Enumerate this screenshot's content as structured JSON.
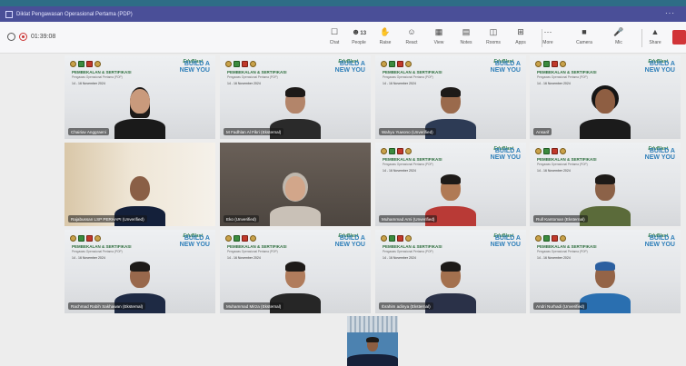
{
  "window": {
    "title": "Diklat Pengawasan Operasional Pertama (PDP)",
    "menu_glyph": "···"
  },
  "meeting": {
    "elapsed": "01:39:08"
  },
  "toolbar": [
    {
      "key": "chat",
      "label": "Chat",
      "icon": "chat-icon",
      "glyph": "☐"
    },
    {
      "key": "people",
      "label": "People",
      "icon": "people-icon",
      "glyph": "☻",
      "count": "13"
    },
    {
      "key": "raise",
      "label": "Raise",
      "icon": "hand-icon",
      "glyph": "✋"
    },
    {
      "key": "react",
      "label": "React",
      "icon": "smile-icon",
      "glyph": "☺"
    },
    {
      "key": "view",
      "label": "View",
      "icon": "grid-icon",
      "glyph": "▦"
    },
    {
      "key": "notes",
      "label": "Notes",
      "icon": "notes-icon",
      "glyph": "▤"
    },
    {
      "key": "rooms",
      "label": "Rooms",
      "icon": "rooms-icon",
      "glyph": "◫"
    },
    {
      "key": "apps",
      "label": "Apps",
      "icon": "apps-icon",
      "glyph": "⊞"
    },
    {
      "key": "more",
      "label": "More",
      "icon": "more-icon",
      "glyph": "···"
    },
    {
      "key": "camera",
      "label": "Camera",
      "icon": "camera-icon",
      "glyph": "■"
    },
    {
      "key": "mic",
      "label": "Mic",
      "icon": "mic-icon",
      "glyph": "🎤"
    },
    {
      "key": "share",
      "label": "Share",
      "icon": "share-icon",
      "glyph": "▲"
    }
  ],
  "banner": {
    "brand": "EduBlast",
    "tagline": "BUILD A NEW YOU",
    "heading": "PEMBEKALAN & SERTIFIKASI",
    "subheading": "Pengawas Operasional Pertama (POP)",
    "dates": "14 - 16   November 2024"
  },
  "participants": [
    {
      "name": "Chairiav Anggraeni",
      "bg": "banner",
      "skin": "#c99a7c",
      "shirt": "#1a1a1a",
      "hair": "long"
    },
    {
      "name": "M Fadhlan Al Fikri (Eksternal)",
      "bg": "banner",
      "skin": "#b3856a",
      "shirt": "#2a2a2a",
      "hair": "short"
    },
    {
      "name": "Wahyu Yuwono (Unverified)",
      "bg": "banner",
      "skin": "#9a6a4c",
      "shirt": "#2d3b55",
      "hair": "short"
    },
    {
      "name": "Ansarif",
      "bg": "banner",
      "skin": "#8e5e42",
      "shirt": "#1b1b1b",
      "hair": "hood"
    },
    {
      "name": "Rajabussan LSP PERHAPI (Unverified)",
      "bg": "room",
      "skin": "#8a5f46",
      "shirt": "#14203a",
      "hair": "bald"
    },
    {
      "name": "Eko (Unverified)",
      "bg": "dark",
      "skin": "#d2a68a",
      "shirt": "#c9c1b7",
      "hair": "hijab"
    },
    {
      "name": "Muhammad Arni (Unverified)",
      "bg": "banner",
      "skin": "#b07a55",
      "shirt": "#b93a36",
      "hair": "short"
    },
    {
      "name": "Rull Kantoman (Eksternal)",
      "bg": "banner",
      "skin": "#8c6248",
      "shirt": "#5b6b3a",
      "hair": "short"
    },
    {
      "name": "Rachmad Rabih Sakhawan (Eksternal)",
      "bg": "banner",
      "skin": "#98684c",
      "shirt": "#1e2a44",
      "hair": "short"
    },
    {
      "name": "Muhammad Mirza (Eksternal)",
      "bg": "banner",
      "skin": "#b07c5c",
      "shirt": "#262626",
      "hair": "short"
    },
    {
      "name": "Ibrahim adinya (Eksternal)",
      "bg": "banner",
      "skin": "#a3704e",
      "shirt": "#2a3148",
      "hair": "short"
    },
    {
      "name": "Andri Nurhadi (Unverified)",
      "bg": "banner",
      "skin": "#946447",
      "shirt": "#2a6fb0",
      "hair": "cap"
    }
  ],
  "self_view": {
    "skin": "#8c5e42",
    "shirt": "#16213a"
  },
  "colors": {
    "titlebar": "#4a4f98",
    "accent_green": "#2c7a4a",
    "accent_blue": "#2f7fb9",
    "leave": "#d13438"
  }
}
